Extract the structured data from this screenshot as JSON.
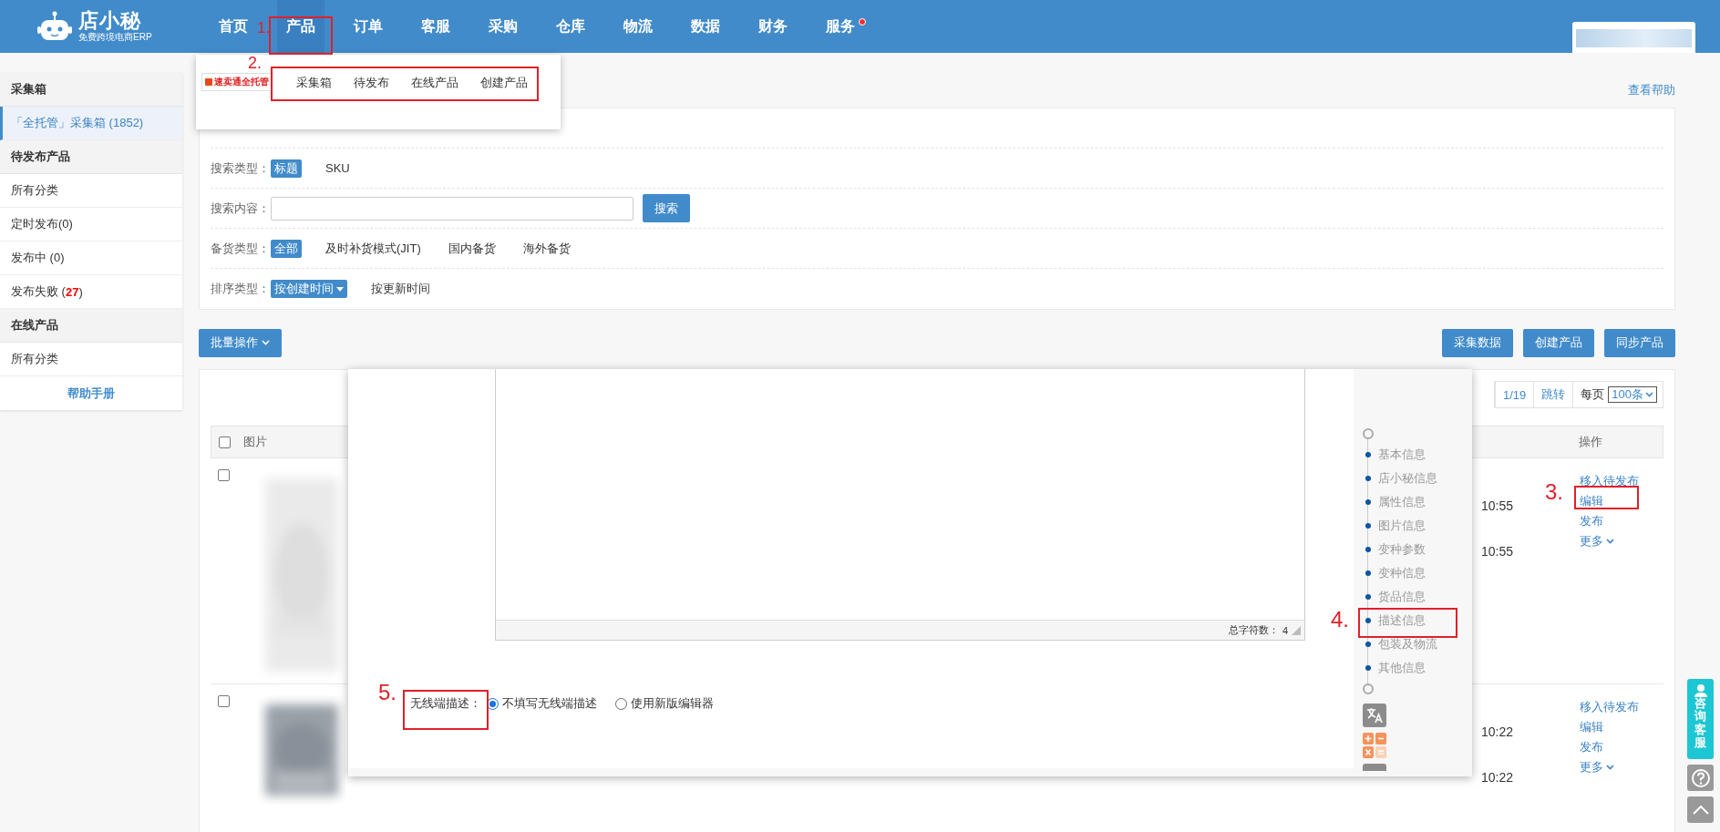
{
  "header": {
    "logo": {
      "name": "店小秘",
      "tagline": "免费跨境电商ERP"
    },
    "nav": [
      {
        "label": "首页",
        "selected": false,
        "badge": false
      },
      {
        "label": "产品",
        "selected": true,
        "badge": false
      },
      {
        "label": "订单",
        "selected": false,
        "badge": false
      },
      {
        "label": "客服",
        "selected": false,
        "badge": false
      },
      {
        "label": "采购",
        "selected": false,
        "badge": false
      },
      {
        "label": "仓库",
        "selected": false,
        "badge": false
      },
      {
        "label": "物流",
        "selected": false,
        "badge": false
      },
      {
        "label": "数据",
        "selected": false,
        "badge": false
      },
      {
        "label": "财务",
        "selected": false,
        "badge": false
      },
      {
        "label": "服务",
        "selected": false,
        "badge": true
      }
    ]
  },
  "nav_dropdown": {
    "badge": "速卖通全托管",
    "items": [
      "采集箱",
      "待发布",
      "在线产品",
      "创建产品"
    ]
  },
  "sidebar": {
    "sections": [
      {
        "title": "采集箱",
        "items": [
          {
            "label": "「全托管」采集箱 (1852)",
            "selected": true
          }
        ]
      },
      {
        "title": "待发布产品",
        "items": [
          {
            "label": "所有分类",
            "selected": false
          },
          {
            "label": "定时发布(0)",
            "selected": false
          },
          {
            "label": "发布中 (0)",
            "selected": false
          },
          {
            "label": "发布失败 (**27**)",
            "selected": false
          }
        ]
      },
      {
        "title": "在线产品",
        "items": [
          {
            "label": "所有分类",
            "selected": false
          }
        ]
      }
    ],
    "help": "帮助手册"
  },
  "help_link": "查看帮助",
  "filters": [
    {
      "label": "搜索类型：",
      "kind": "options",
      "options": [
        {
          "label": "标题",
          "selected": true
        },
        {
          "label": "SKU",
          "selected": false
        }
      ]
    },
    {
      "label": "搜索内容：",
      "kind": "search",
      "button": "搜索"
    },
    {
      "label": "备货类型：",
      "kind": "options",
      "options": [
        {
          "label": "全部",
          "selected": true
        },
        {
          "label": "及时补货模式(JIT)",
          "selected": false
        },
        {
          "label": "国内备货",
          "selected": false
        },
        {
          "label": "海外备货",
          "selected": false
        }
      ]
    },
    {
      "label": "排序类型：",
      "kind": "options",
      "options": [
        {
          "label": "按创建时间",
          "selected": true,
          "dropdown": true
        },
        {
          "label": "按更新时间",
          "selected": false,
          "dropdown": false
        }
      ]
    }
  ],
  "toolbar": {
    "bulk": "批量操作",
    "buttons": [
      "采集数据",
      "创建产品",
      "同步产品"
    ]
  },
  "table": {
    "pagination": {
      "page": "1/19",
      "jump": "跳转",
      "per_page_label": "每页",
      "per_page": "100条"
    },
    "columns": [
      "图片",
      "操作"
    ],
    "select_all_checked": false,
    "rows": [
      {
        "checked": false,
        "times": [
          "10:55",
          "10:55"
        ],
        "actions": [
          {
            "label": "移入待发布",
            "menu": false
          },
          {
            "label": "编辑",
            "menu": false
          },
          {
            "label": "发布",
            "menu": false
          },
          {
            "label": "更多",
            "menu": true
          }
        ]
      },
      {
        "checked": false,
        "times": [
          "10:22",
          "10:22"
        ],
        "actions": [
          {
            "label": "移入待发布",
            "menu": false
          },
          {
            "label": "编辑",
            "menu": false
          },
          {
            "label": "发布",
            "menu": false
          },
          {
            "label": "更多",
            "menu": true
          }
        ]
      }
    ]
  },
  "modal": {
    "char_count_label": "总字符数：",
    "char_count": "4",
    "mobile_label": "无线端描述：",
    "radios": [
      {
        "label": "不填写无线端描述",
        "selected": true
      },
      {
        "label": "使用新版编辑器",
        "selected": false
      }
    ],
    "nav": [
      "基本信息",
      "店小秘信息",
      "属性信息",
      "图片信息",
      "变种参数",
      "变种信息",
      "货品信息",
      "描述信息",
      "包装及物流",
      "其他信息"
    ]
  },
  "annotations": [
    "1.",
    "2.",
    "3.",
    "4.",
    "5."
  ],
  "service_button": "咨询客服"
}
